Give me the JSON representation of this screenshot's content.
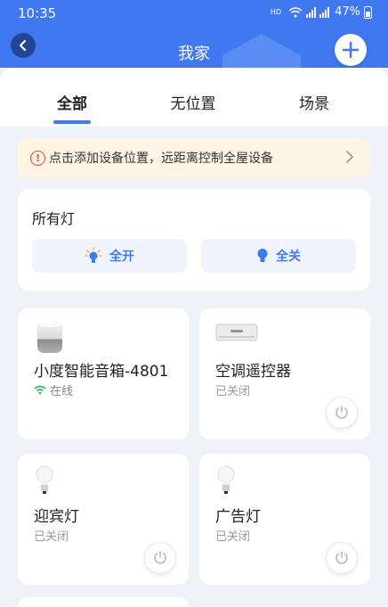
{
  "status_bar": {
    "time": "10:35",
    "network": "HD",
    "battery": "47%"
  },
  "header": {
    "title": "我家"
  },
  "tabs": [
    {
      "label": "全部",
      "active": true
    },
    {
      "label": "无位置",
      "active": false
    },
    {
      "label": "场景",
      "active": false
    }
  ],
  "notice": {
    "text": "点击添加设备位置，远距离控制全屋设备"
  },
  "lights": {
    "title": "所有灯",
    "all_on": "全开",
    "all_off": "全关"
  },
  "devices": [
    {
      "name": "小度智能音箱-4801",
      "status": "在线",
      "icon": "speaker-icon"
    },
    {
      "name": "空调遥控器",
      "status": "已关闭",
      "icon": "air-conditioner-icon"
    },
    {
      "name": "迎宾灯",
      "status": "已关闭",
      "icon": "light-bulb-icon"
    },
    {
      "name": "广告灯",
      "status": "已关闭",
      "icon": "light-bulb-icon"
    }
  ],
  "colors": {
    "primary": "#3f78f0",
    "notice_bg": "#fdf4e3",
    "alert": "#e44a3c",
    "online": "#2fb85a"
  }
}
